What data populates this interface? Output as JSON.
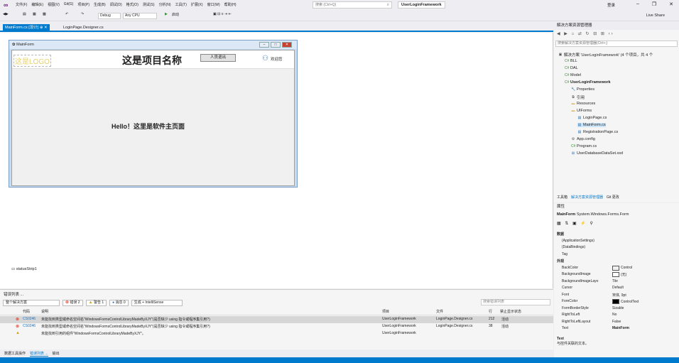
{
  "title_bar": {
    "menu": [
      "文件(F)",
      "编辑(E)",
      "视图(V)",
      "Git(G)",
      "项目(P)",
      "生成(B)",
      "调试(D)",
      "格式(O)",
      "测试(S)",
      "分析(N)",
      "工具(T)",
      "扩展(X)",
      "窗口(W)",
      "帮助(H)"
    ],
    "search_placeholder": "搜索 (Ctrl+Q)",
    "solution_name": "UserLoginFramework",
    "sign_in": "登录"
  },
  "toolbar": {
    "config": "Debug",
    "platform": "Any CPU",
    "start_label": "启动",
    "live_share": "Live Share"
  },
  "doc_tabs": [
    {
      "label": "MainForm.cs [设计]",
      "active": true
    },
    {
      "label": "LoginPage.Designer.cs",
      "active": false
    }
  ],
  "designer": {
    "form_title": "MainForm",
    "logo_text": "这是LOGO",
    "project_name": "这是项目名称",
    "logout_label": "人员退出",
    "welcome_label": "欢迎您",
    "hello_text": "Hello！这里是软件主页面",
    "status_strip": "statusStrip1"
  },
  "error_list": {
    "title": "错误列表 ...",
    "scope": "整个解决方案",
    "errors_label": "错误 2",
    "warnings_label": "警告 1",
    "messages_label": "消息 0",
    "build_filter": "生成 + IntelliSense",
    "search_placeholder": "搜索错误列表",
    "columns": [
      "代码",
      "说明",
      "项目",
      "文件",
      "行",
      "禁止显示状态"
    ],
    "rows": [
      {
        "type": "error",
        "code": "CS0246",
        "desc": "未能找到类型或命名空间名\"WindowsFormsControlLibraryMadeByXJY\"(是否缺少 using 指令或程序集引用?)",
        "project": "UserLoginFramework",
        "file": "LoginPage.Designer.cs",
        "line": "212",
        "state": "活动"
      },
      {
        "type": "error",
        "code": "CS0246",
        "desc": "未能找到类型或命名空间名\"WindowsFormsControlLibraryMadeByXJY\"(是否缺少 using 指令或程序集引用?)",
        "project": "UserLoginFramework",
        "file": "LoginPage.Designer.cs",
        "line": "38",
        "state": "活动"
      },
      {
        "type": "warning",
        "code": "",
        "desc": "未能找到引用的组件\"WindowsFormsControlLibraryMadeByXJY\"。",
        "project": "UserLoginFramework",
        "file": "",
        "line": "",
        "state": ""
      }
    ]
  },
  "bottom_tabs": [
    {
      "label": "数据工具操作",
      "active": false
    },
    {
      "label": "错误列表 ...",
      "active": true
    },
    {
      "label": "输出",
      "active": false
    }
  ],
  "solution_explorer": {
    "title": "解决方案资源管理器",
    "search_placeholder": "搜索解决方案资源管理器(Ctrl+;)",
    "items": [
      {
        "label": "解决方案 'UserLoginFramework' (4 个项目，共 4 个",
        "level": 0,
        "icon": "solution-icon"
      },
      {
        "label": "BLL",
        "level": 1,
        "icon": "csharp-project-icon"
      },
      {
        "label": "DAL",
        "level": 1,
        "icon": "csharp-project-icon"
      },
      {
        "label": "Model",
        "level": 1,
        "icon": "csharp-project-icon"
      },
      {
        "label": "UserLoginFramework",
        "level": 1,
        "icon": "csharp-project-icon",
        "bold": true
      },
      {
        "label": "Properties",
        "level": 2,
        "icon": "wrench-icon"
      },
      {
        "label": "引用",
        "level": 2,
        "icon": "references-icon"
      },
      {
        "label": "Resources",
        "level": 2,
        "icon": "folder-icon"
      },
      {
        "label": "UIForms",
        "level": 2,
        "icon": "folder-icon"
      },
      {
        "label": "LoginPage.cs",
        "level": 3,
        "icon": "form-icon"
      },
      {
        "label": "MainForm.cs",
        "level": 3,
        "icon": "form-icon",
        "selected": true
      },
      {
        "label": "RegistrationPage.cs",
        "level": 3,
        "icon": "form-icon"
      },
      {
        "label": "App.config",
        "level": 2,
        "icon": "config-icon"
      },
      {
        "label": "Program.cs",
        "level": 2,
        "icon": "csharp-file-icon"
      },
      {
        "label": "UserDatabaseDataSet.xsd",
        "level": 2,
        "icon": "dataset-icon"
      }
    ],
    "tabs": [
      "工具箱",
      "解决方案资源管理器",
      "Git 更改"
    ]
  },
  "properties": {
    "title": "属性",
    "object": "MainForm",
    "object_type": "System.Windows.Forms.Form",
    "rows": [
      {
        "key": "数据",
        "value": "",
        "category": true
      },
      {
        "key": "(ApplicationSettings)",
        "value": ""
      },
      {
        "key": "(DataBindings)",
        "value": ""
      },
      {
        "key": "Tag",
        "value": ""
      },
      {
        "key": "外观",
        "value": "",
        "category": true
      },
      {
        "key": "BackColor",
        "value": "Control",
        "swatch": "#f0f0f0"
      },
      {
        "key": "BackgroundImage",
        "value": "(无)",
        "swatch": "#ffffff"
      },
      {
        "key": "BackgroundImageLayo",
        "value": "Tile"
      },
      {
        "key": "Cursor",
        "value": "Default"
      },
      {
        "key": "Font",
        "value": "宋体, 9pt"
      },
      {
        "key": "ForeColor",
        "value": "ControlText",
        "swatch": "#000000"
      },
      {
        "key": "FormBorderStyle",
        "value": "Sizable"
      },
      {
        "key": "RightToLeft",
        "value": "No"
      },
      {
        "key": "RightToLeftLayout",
        "value": "False"
      },
      {
        "key": "Text",
        "value": "MainForm",
        "bold": true
      }
    ],
    "desc_title": "Text",
    "desc_text": "与控件关联的文本。"
  },
  "colors": {
    "accent": "#007acc",
    "error": "#e51400",
    "warning": "#d4a017"
  }
}
